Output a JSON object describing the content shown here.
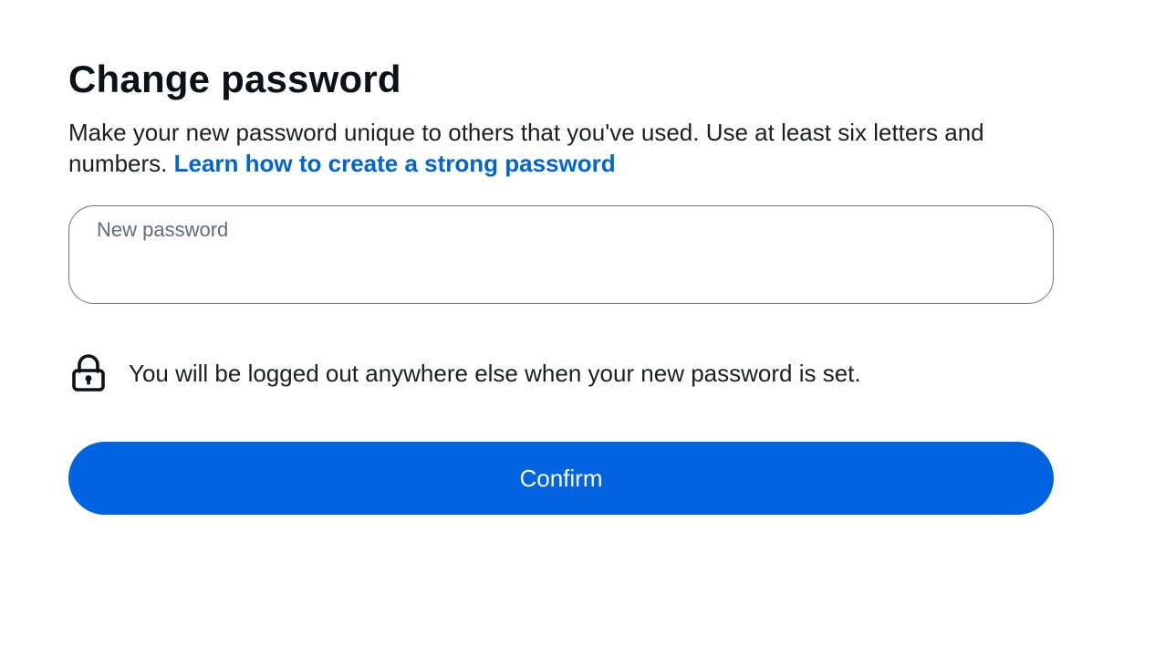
{
  "header": {
    "title": "Change password"
  },
  "description": {
    "text": "Make your new password unique to others that you've used. Use at least six letters and numbers.",
    "link_label": "Learn how to create a strong password"
  },
  "password_field": {
    "label": "New password",
    "value": ""
  },
  "notice": {
    "icon": "lock-icon",
    "text": "You will be logged out anywhere else when your new password is set."
  },
  "confirm_button": {
    "label": "Confirm"
  },
  "colors": {
    "accent": "#0064e0",
    "link": "#0064d1",
    "field_border": "#66778a",
    "label": "#5f6d7d"
  }
}
